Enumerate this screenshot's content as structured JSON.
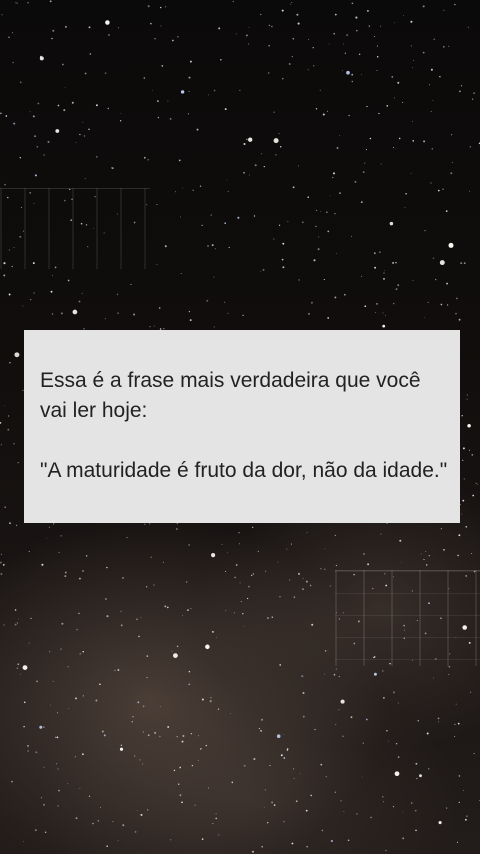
{
  "caption": {
    "intro": "Essa é a frase mais verdadeira que você vai ler hoje:",
    "quote": "\"A maturidade é fruto da dor, não da idade.\""
  },
  "background": {
    "icon": "starry-night-sky",
    "card_color": "#e4e4e4",
    "text_color": "#222222"
  }
}
